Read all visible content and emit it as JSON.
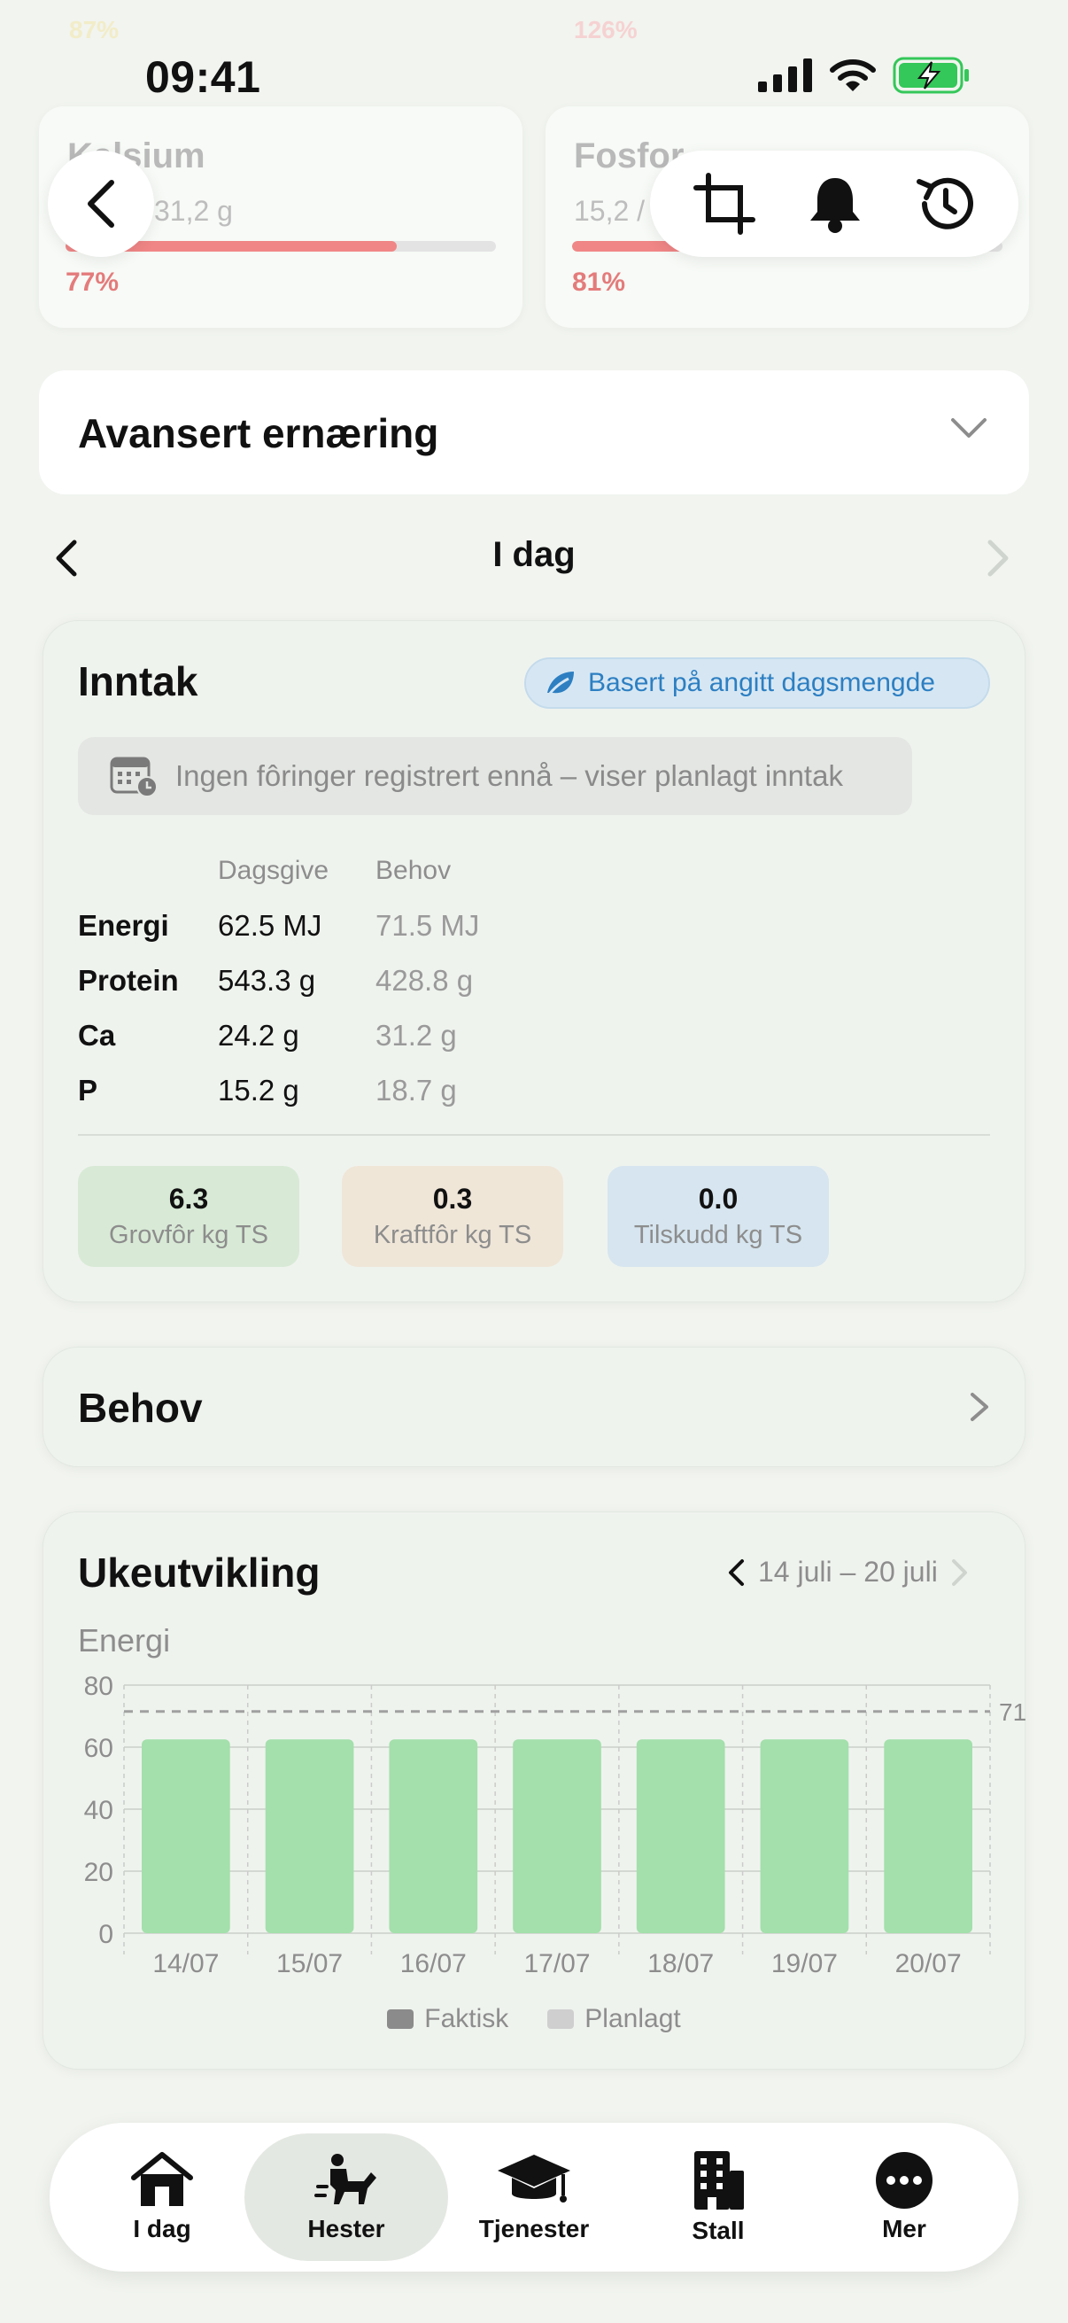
{
  "status": {
    "time": "09:41"
  },
  "top_remnants": {
    "pct_left": "87%",
    "pct_right": "126%"
  },
  "minerals": [
    {
      "name": "Kalsium",
      "value": "31,2 g",
      "percent_label": "77%",
      "progress": 0.77
    },
    {
      "name": "Fosfor",
      "value": "15,2 /",
      "percent_label": "81%",
      "progress": 0.81
    }
  ],
  "advanced": {
    "title": "Avansert ernæring"
  },
  "day_nav": {
    "title": "I dag"
  },
  "intake": {
    "title": "Inntak",
    "badge": "Basert på angitt dagsmengde",
    "info": "Ingen fôringer registrert ennå – viser planlagt inntak",
    "col_daily": "Dagsgive",
    "col_need": "Behov",
    "rows": [
      {
        "label": "Energi",
        "daily": "62.5 MJ",
        "need": "71.5 MJ"
      },
      {
        "label": "Protein",
        "daily": "543.3 g",
        "need": "428.8 g"
      },
      {
        "label": "Ca",
        "daily": "24.2 g",
        "need": "31.2 g"
      },
      {
        "label": "P",
        "daily": "15.2 g",
        "need": "18.7 g"
      }
    ],
    "stats": [
      {
        "value": "6.3",
        "label": "Grovfôr kg TS",
        "color": "#d8ead6"
      },
      {
        "value": "0.3",
        "label": "Kraftfôr kg TS",
        "color": "#efe6d8"
      },
      {
        "value": "0.0",
        "label": "Tilskudd kg TS",
        "color": "#d6e5ef"
      }
    ]
  },
  "behov": {
    "title": "Behov"
  },
  "weekly": {
    "title": "Ukeutvikling",
    "range": "14 juli – 20 juli"
  },
  "chart_data": {
    "type": "bar",
    "ylabel": "Energi",
    "categories": [
      "14/07",
      "15/07",
      "16/07",
      "17/07",
      "18/07",
      "19/07",
      "20/07"
    ],
    "series": [
      {
        "name": "Planlagt",
        "values": [
          62.5,
          62.5,
          62.5,
          62.5,
          62.5,
          62.5,
          62.5
        ],
        "color": "#a3e0ab"
      }
    ],
    "reference_line": {
      "value": 71.5,
      "label": "71"
    },
    "ylim": [
      0,
      80
    ],
    "yticks": [
      0,
      20,
      40,
      60,
      80
    ],
    "legend": [
      {
        "name": "Faktisk",
        "color": "#8b8b8b"
      },
      {
        "name": "Planlagt",
        "color": "#cfcfcf"
      }
    ],
    "grid": true,
    "legend_position": "bottom"
  },
  "tabs": [
    {
      "label": "I dag",
      "icon": "home-icon"
    },
    {
      "label": "Hester",
      "icon": "horse-rider-icon",
      "active": true
    },
    {
      "label": "Tjenester",
      "icon": "graduation-cap-icon"
    },
    {
      "label": "Stall",
      "icon": "building-icon"
    },
    {
      "label": "Mer",
      "icon": "more-icon"
    }
  ]
}
